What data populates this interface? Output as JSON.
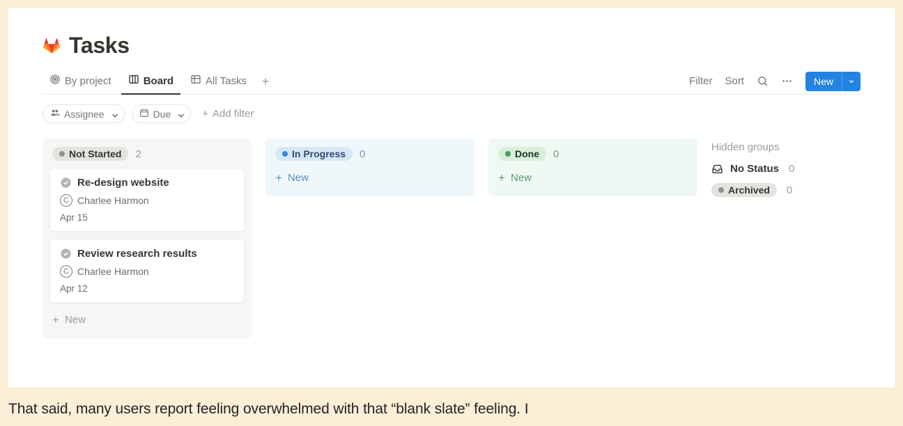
{
  "header": {
    "title": "Tasks"
  },
  "tabs": {
    "items": [
      {
        "label": "By project"
      },
      {
        "label": "Board"
      },
      {
        "label": "All Tasks"
      }
    ]
  },
  "toolbar": {
    "filter": "Filter",
    "sort": "Sort",
    "new": "New"
  },
  "filters": {
    "assignee": "Assignee",
    "due": "Due",
    "add": "Add filter"
  },
  "columns": {
    "not_started": {
      "label": "Not Started",
      "count": "2",
      "cards": [
        {
          "title": "Re-design website",
          "assignee_initial": "C",
          "assignee": "Charlee Harmon",
          "date": "Apr 15"
        },
        {
          "title": "Review research results",
          "assignee_initial": "C",
          "assignee": "Charlee Harmon",
          "date": "Apr 12"
        }
      ],
      "new": "New"
    },
    "in_progress": {
      "label": "In Progress",
      "count": "0",
      "new": "New"
    },
    "done": {
      "label": "Done",
      "count": "0",
      "new": "New"
    }
  },
  "hidden": {
    "title": "Hidden groups",
    "no_status": {
      "label": "No Status",
      "count": "0"
    },
    "archived": {
      "label": "Archived",
      "count": "0"
    }
  },
  "footer": "That said, many users report feeling overwhelmed with that “blank slate” feeling. I"
}
